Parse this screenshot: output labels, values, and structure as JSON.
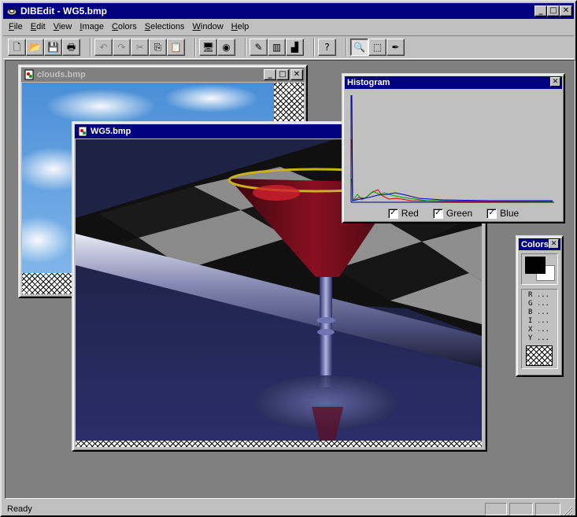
{
  "app": {
    "title": "DIBEdit - WG5.bmp",
    "buttons": {
      "minimize": "_",
      "maximize": "□",
      "close": "✕"
    }
  },
  "menu": [
    "File",
    "Edit",
    "View",
    "Image",
    "Colors",
    "Selections",
    "Window",
    "Help"
  ],
  "toolbar": {
    "groups": [
      [
        {
          "name": "new-icon",
          "glyph": "🗋"
        },
        {
          "name": "open-icon",
          "glyph": "📂"
        },
        {
          "name": "save-icon",
          "glyph": "💾"
        },
        {
          "name": "print-icon",
          "glyph": "🖶"
        }
      ],
      [
        {
          "name": "undo-icon",
          "glyph": "↶",
          "disabled": true
        },
        {
          "name": "redo-icon",
          "glyph": "↷",
          "disabled": true
        },
        {
          "name": "cut-icon",
          "glyph": "✂",
          "disabled": true
        },
        {
          "name": "copy-icon",
          "glyph": "⎘"
        },
        {
          "name": "paste-icon",
          "glyph": "📋"
        }
      ],
      [
        {
          "name": "display-icon",
          "glyph": "🖥"
        },
        {
          "name": "palette-icon",
          "glyph": "◉"
        }
      ],
      [
        {
          "name": "pencil-icon",
          "glyph": "✎"
        },
        {
          "name": "color-bars-icon",
          "glyph": "▥"
        },
        {
          "name": "histogram-icon",
          "glyph": "▟"
        }
      ],
      [
        {
          "name": "help-icon",
          "glyph": "?"
        }
      ],
      [
        {
          "name": "zoom-icon",
          "glyph": "🔍",
          "pressed": true
        },
        {
          "name": "select-rect-icon",
          "glyph": "⬚"
        },
        {
          "name": "eyedropper-icon",
          "glyph": "✒"
        }
      ]
    ]
  },
  "windows": {
    "clouds": {
      "title": "clouds.bmp"
    },
    "wg5": {
      "title": "WG5.bmp"
    },
    "histogram": {
      "title": "Histogram",
      "channels": [
        {
          "label": "Red",
          "checked": true,
          "color": "#e00000"
        },
        {
          "label": "Green",
          "checked": true,
          "color": "#00a000"
        },
        {
          "label": "Blue",
          "checked": true,
          "color": "#0000c0"
        }
      ],
      "check_glyph": "✓"
    },
    "colors": {
      "title": "Colors",
      "fields": [
        "R ...",
        "G ...",
        "B ...",
        "I ...",
        "X ...",
        "Y ..."
      ]
    }
  },
  "status": {
    "text": "Ready"
  }
}
